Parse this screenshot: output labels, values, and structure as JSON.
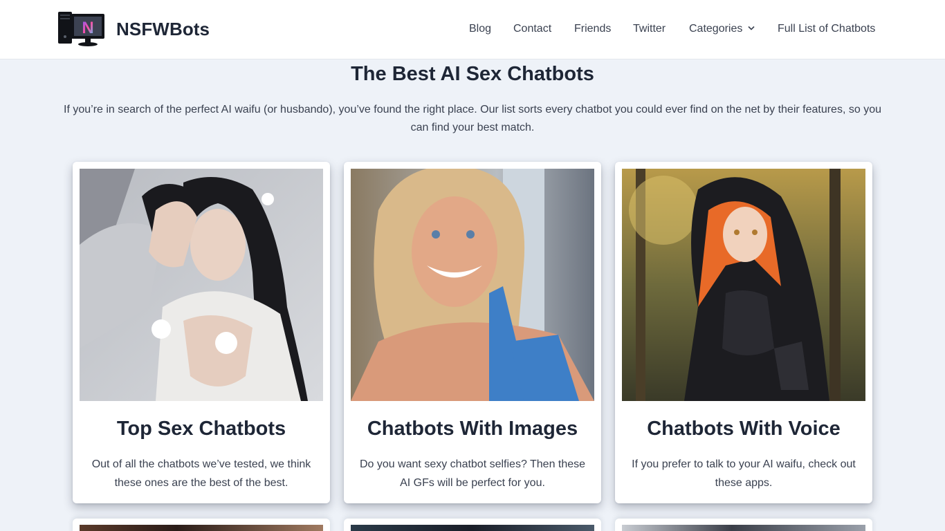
{
  "header": {
    "site_title": "NSFWBots",
    "logo_letter": "N",
    "nav": [
      {
        "label": "Blog"
      },
      {
        "label": "Contact"
      },
      {
        "label": "Friends"
      },
      {
        "label": "Twitter"
      },
      {
        "label": "Categories"
      },
      {
        "label": "Full List of Chatbots"
      }
    ]
  },
  "main": {
    "title": "The Best AI Sex Chatbots",
    "intro": "If you’re in search of the perfect AI waifu (or husbando), you’ve found the right place. Our list sorts every chatbot you could ever find on the net by their features, so you can find your best match.",
    "cards": [
      {
        "title": "Top Sex Chatbots",
        "description": "Out of all the chatbots we’ve tested, we think these ones are the best of the best.",
        "image": "woman-in-white-dress-photo"
      },
      {
        "title": "Chatbots With Images",
        "description": "Do you want sexy chatbot selfies? Then these AI GFs will be perfect for you.",
        "image": "smiling-blonde-woman-photo"
      },
      {
        "title": "Chatbots With Voice",
        "description": "If you prefer to talk to your AI waifu, check out these apps.",
        "image": "anime-hooded-girl-illustration"
      }
    ]
  },
  "colors": {
    "background": "#eef2f8",
    "header": "#ffffff",
    "text_dark": "#1e2636",
    "text_body": "#3a4150"
  }
}
